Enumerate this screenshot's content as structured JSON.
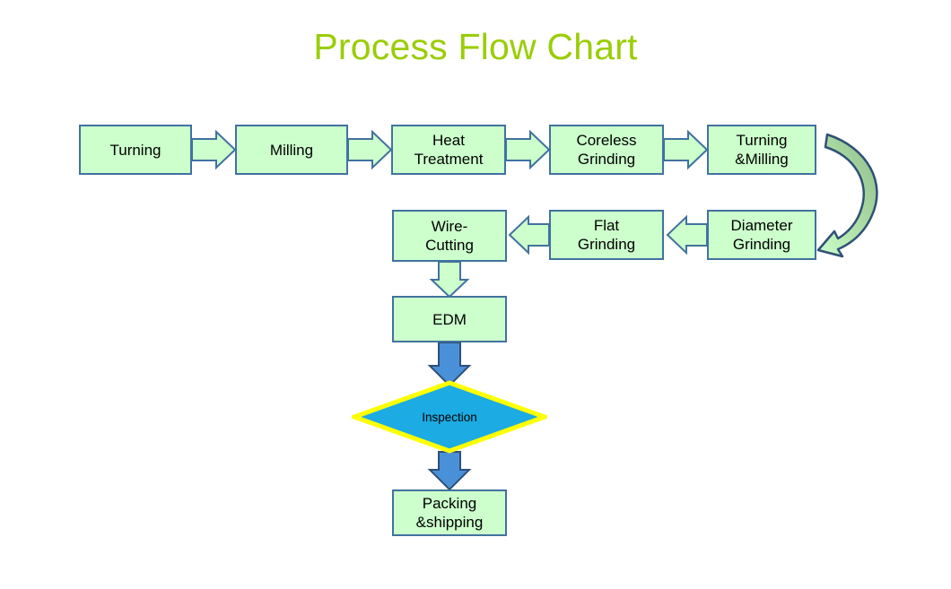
{
  "title": "Process Flow Chart",
  "theme": {
    "title_color": "#9ACD07",
    "node_fill": "#CCFFCC",
    "node_border": "#41729F",
    "arrow_fill_green": "#CCFFCC",
    "arrow_fill_blue": "#4A90D9",
    "decision_fill": "#1CABE2",
    "decision_border": "#FFFF00",
    "text_color": "#000000",
    "background": "#FFFFFF"
  },
  "chart_data": {
    "type": "diagram",
    "title": "Process Flow Chart",
    "diagram_kind": "process-flowchart",
    "nodes": [
      {
        "id": "turning",
        "label": "Turning",
        "shape": "process",
        "row": 1,
        "order": 1
      },
      {
        "id": "milling",
        "label": "Milling",
        "shape": "process",
        "row": 1,
        "order": 2
      },
      {
        "id": "heat-treatment",
        "label": "Heat\nTreatment",
        "shape": "process",
        "row": 1,
        "order": 3
      },
      {
        "id": "coreless-grinding",
        "label": "Coreless\nGrinding",
        "shape": "process",
        "row": 1,
        "order": 4
      },
      {
        "id": "turning-milling",
        "label": "Turning\n&Milling",
        "shape": "process",
        "row": 1,
        "order": 5
      },
      {
        "id": "diameter-grinding",
        "label": "Diameter\nGrinding",
        "shape": "process",
        "row": 2,
        "order": 1
      },
      {
        "id": "flat-grinding",
        "label": "Flat\nGrinding",
        "shape": "process",
        "row": 2,
        "order": 2
      },
      {
        "id": "wire-cutting",
        "label": "Wire-\nCutting",
        "shape": "process",
        "row": 2,
        "order": 3
      },
      {
        "id": "edm",
        "label": "EDM",
        "shape": "process",
        "row": 3,
        "order": 1
      },
      {
        "id": "inspection",
        "label": "Inspection",
        "shape": "decision",
        "row": 4,
        "order": 1
      },
      {
        "id": "packing-shipping",
        "label": "Packing\n&shipping",
        "shape": "process",
        "row": 5,
        "order": 1
      }
    ],
    "edges": [
      {
        "from": "turning",
        "to": "milling",
        "direction": "right",
        "style": "block-arrow-green"
      },
      {
        "from": "milling",
        "to": "heat-treatment",
        "direction": "right",
        "style": "block-arrow-green"
      },
      {
        "from": "heat-treatment",
        "to": "coreless-grinding",
        "direction": "right",
        "style": "block-arrow-green"
      },
      {
        "from": "coreless-grinding",
        "to": "turning-milling",
        "direction": "right",
        "style": "block-arrow-green"
      },
      {
        "from": "turning-milling",
        "to": "diameter-grinding",
        "direction": "curve-down-left",
        "style": "curved-arrow-green"
      },
      {
        "from": "diameter-grinding",
        "to": "flat-grinding",
        "direction": "left",
        "style": "block-arrow-green"
      },
      {
        "from": "flat-grinding",
        "to": "wire-cutting",
        "direction": "left",
        "style": "block-arrow-green"
      },
      {
        "from": "wire-cutting",
        "to": "edm",
        "direction": "down",
        "style": "block-arrow-green"
      },
      {
        "from": "edm",
        "to": "inspection",
        "direction": "down",
        "style": "block-arrow-blue"
      },
      {
        "from": "inspection",
        "to": "packing-shipping",
        "direction": "down",
        "style": "block-arrow-blue"
      }
    ]
  },
  "nodes": {
    "turning": {
      "label": "Turning"
    },
    "milling": {
      "label": "Milling"
    },
    "heat_treatment": {
      "label": "Heat\nTreatment"
    },
    "coreless_grinding": {
      "label": "Coreless\nGrinding"
    },
    "turning_milling": {
      "label": "Turning\n&Milling"
    },
    "diameter_grinding": {
      "label": "Diameter\nGrinding"
    },
    "flat_grinding": {
      "label": "Flat\nGrinding"
    },
    "wire_cutting": {
      "label": "Wire-\nCutting"
    },
    "edm": {
      "label": "EDM"
    },
    "inspection": {
      "label": "Inspection"
    },
    "packing_shipping": {
      "label": "Packing\n&shipping"
    }
  }
}
